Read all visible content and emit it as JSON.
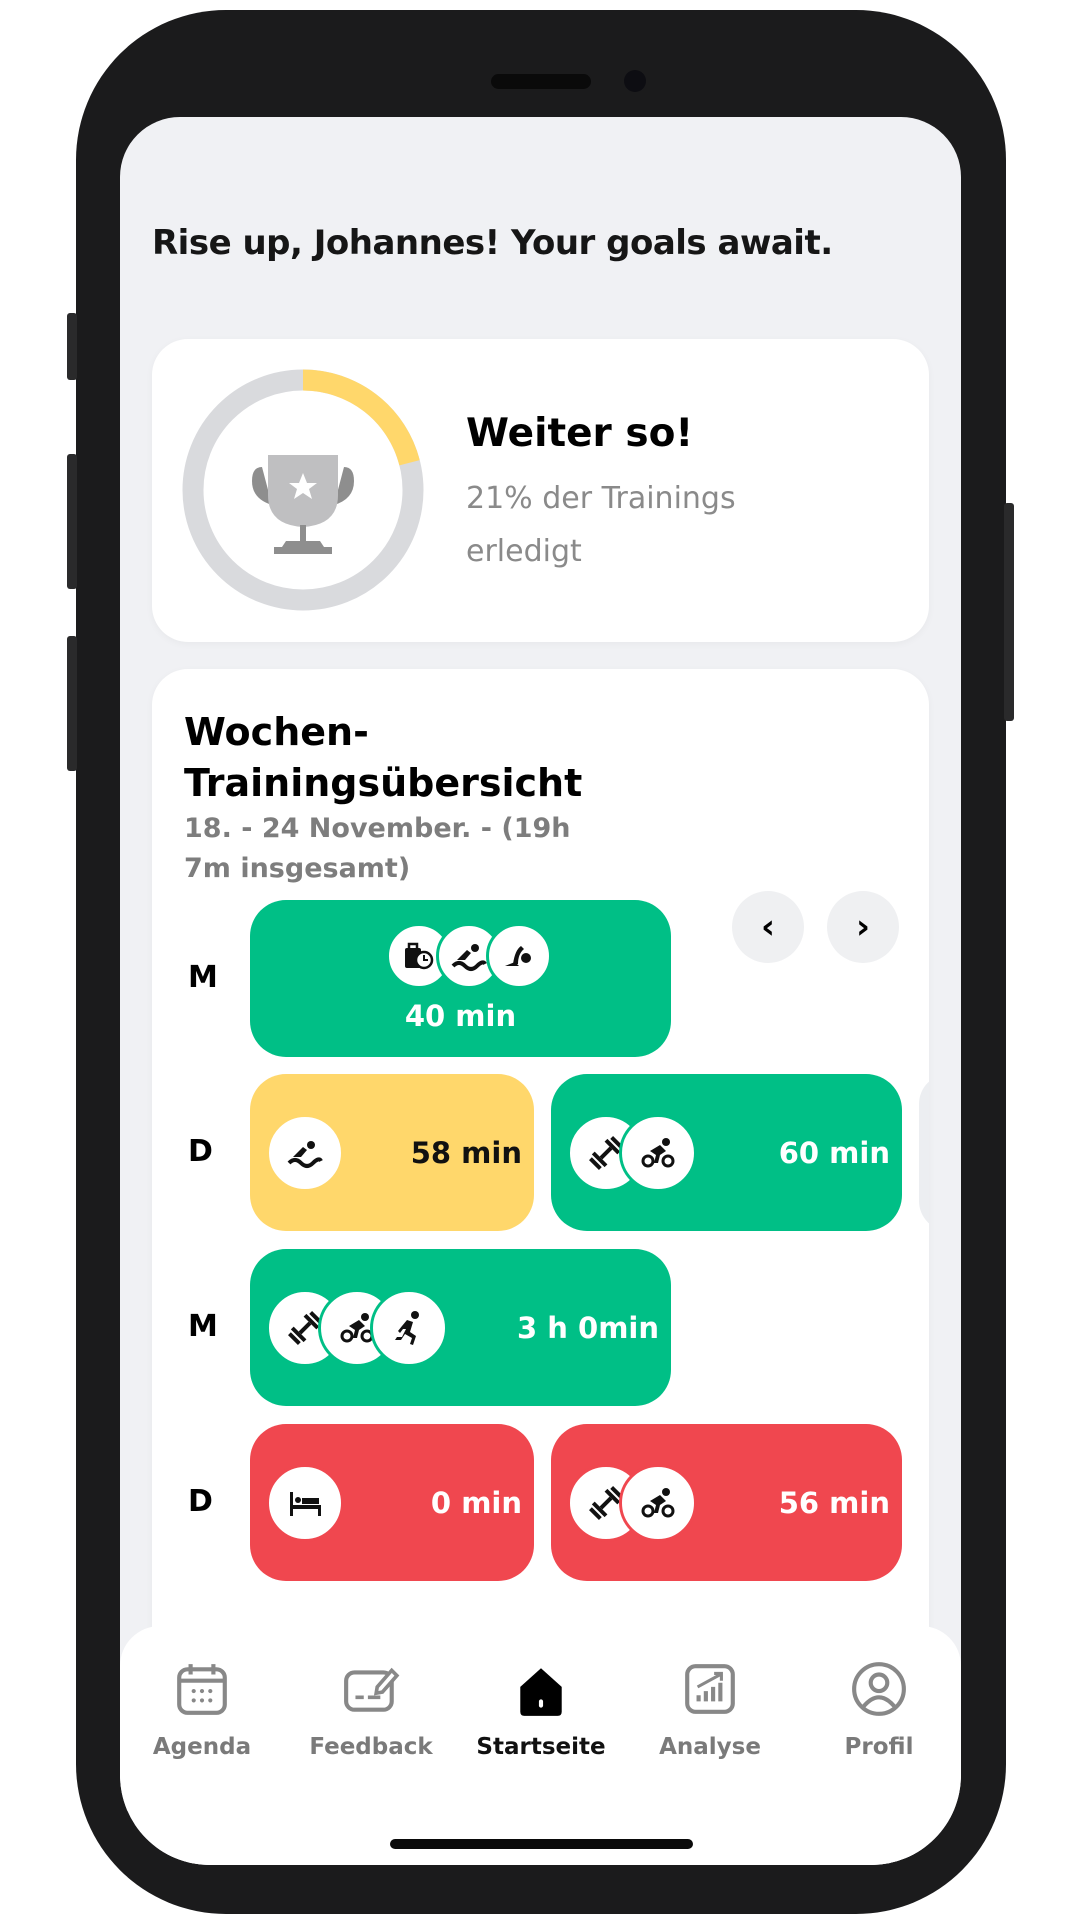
{
  "greeting": "Rise up, Johannes! Your goals await.",
  "progress": {
    "title": "Weiter so!",
    "subtitle": "21% der Trainings erledigt",
    "percent": 21,
    "track_color": "#d9dadd",
    "fill_color": "#ffd76b",
    "icon": "trophy-icon"
  },
  "week": {
    "title": "Wochen-Trainingsübersicht",
    "subtitle": "18. - 24 November. - (19h 7m insgesamt)",
    "prev_label": "‹",
    "next_label": "›",
    "days": [
      {
        "day": "M",
        "sessions": [
          {
            "status": "completed",
            "color": "#00bf86",
            "icons": [
              "bag-clock-icon",
              "swim-icon",
              "open-water-icon"
            ],
            "duration": "40 min"
          }
        ]
      },
      {
        "day": "D",
        "sessions": [
          {
            "status": "partial",
            "color": "#ffd76b",
            "icons": [
              "swim-icon"
            ],
            "duration": "58 min"
          },
          {
            "status": "completed",
            "color": "#00bf86",
            "icons": [
              "dumbbell-icon",
              "bike-icon"
            ],
            "duration": "60 min"
          }
        ]
      },
      {
        "day": "M",
        "sessions": [
          {
            "status": "completed",
            "color": "#00bf86",
            "icons": [
              "dumbbell-icon",
              "bike-icon",
              "run-icon"
            ],
            "duration": "3 h 0min"
          }
        ]
      },
      {
        "day": "D",
        "sessions": [
          {
            "status": "missed",
            "color": "#f0474f",
            "icons": [
              "bed-icon"
            ],
            "duration": "0 min"
          },
          {
            "status": "missed",
            "color": "#f0474f",
            "icons": [
              "dumbbell-icon",
              "bike-icon"
            ],
            "duration": "56 min"
          }
        ]
      }
    ]
  },
  "nav": [
    {
      "label": "Agenda",
      "icon": "calendar-icon",
      "active": false
    },
    {
      "label": "Feedback",
      "icon": "feedback-icon",
      "active": false
    },
    {
      "label": "Startseite",
      "icon": "home-icon",
      "active": true
    },
    {
      "label": "Analyse",
      "icon": "chart-icon",
      "active": false
    },
    {
      "label": "Profil",
      "icon": "profile-icon",
      "active": false
    }
  ]
}
